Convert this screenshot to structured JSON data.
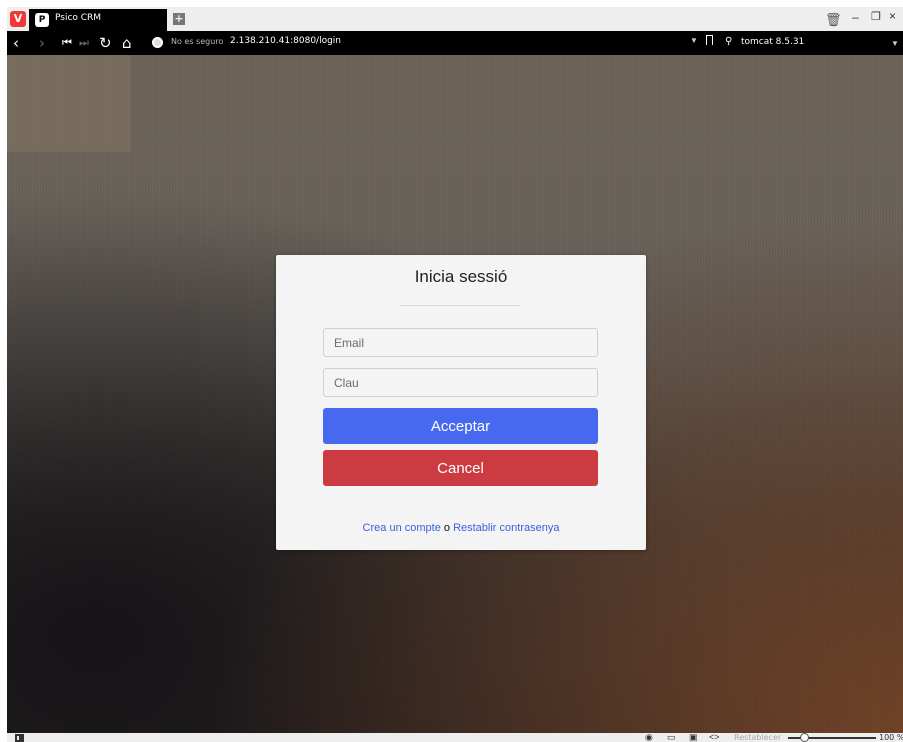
{
  "browser": {
    "tab": {
      "title": "Psico CRM",
      "favicon_letter": "P"
    },
    "brand_letter": "V",
    "address": {
      "security": "No es seguro",
      "url": "2.138.210.41:8080/login"
    },
    "search": {
      "value": "tomcat 8.5.31"
    },
    "status": {
      "reset_label": "Restablecer",
      "zoom": "100 %"
    },
    "icons": [
      "vivaldi-logo-icon",
      "new-tab-icon",
      "trash-icon",
      "back-icon",
      "forward-icon",
      "rewind-icon",
      "fast-forward-icon",
      "reload-icon",
      "home-icon",
      "globe-icon",
      "bookmark-icon",
      "search-icon",
      "panel-toggle-icon",
      "capture-icon",
      "tile-icon",
      "image-icon",
      "code-icon"
    ]
  },
  "login": {
    "title": "Inicia sessió",
    "email_placeholder": "Email",
    "password_placeholder": "Clau",
    "accept_label": "Acceptar",
    "cancel_label": "Cancel",
    "create_account_link": "Crea un compte",
    "or_text": "o",
    "reset_password_link": "Restablir contrasenya"
  },
  "colors": {
    "accept": "#4769f0",
    "cancel": "#cc3b42",
    "link": "#3b5fde",
    "card": "#f4f4f4"
  }
}
